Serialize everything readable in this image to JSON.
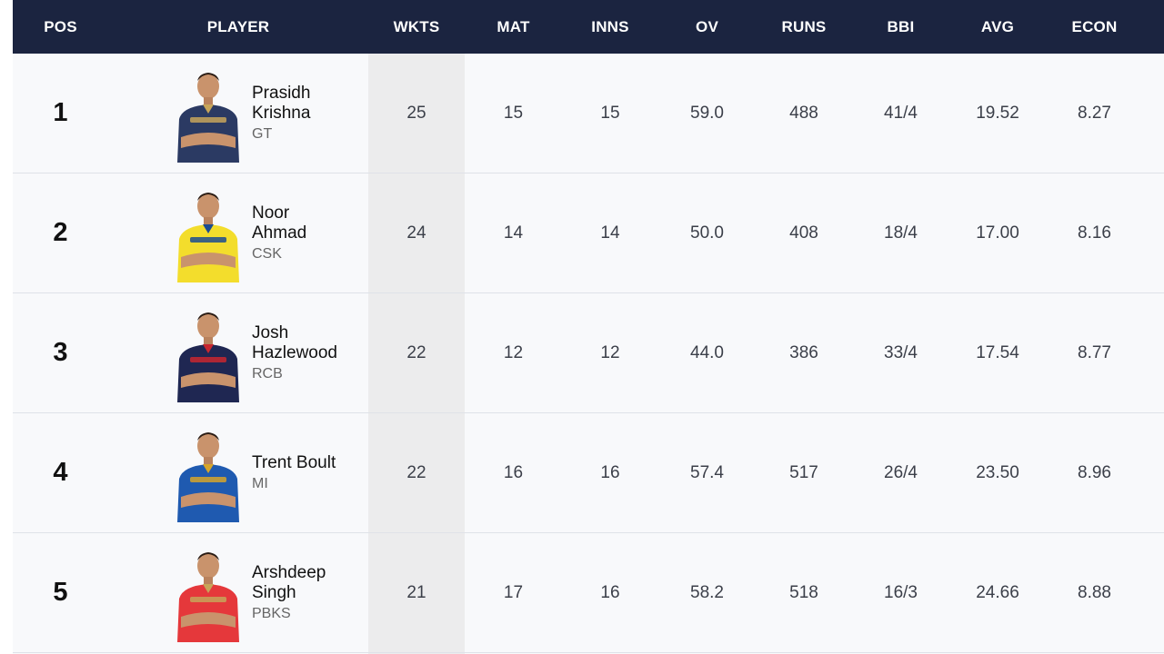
{
  "header": {
    "pos": "POS",
    "player": "PLAYER",
    "wkts": "WKTS",
    "mat": "MAT",
    "inns": "INNS",
    "ov": "OV",
    "runs": "RUNS",
    "bbi": "BBI",
    "avg": "AVG",
    "econ": "ECON"
  },
  "rows": [
    {
      "pos": "1",
      "first": "Prasidh",
      "last": "Krishna",
      "team": "GT",
      "jersey": "#2b3a63",
      "trim": "#c7a55a",
      "wkts": "25",
      "mat": "15",
      "inns": "15",
      "ov": "59.0",
      "runs": "488",
      "bbi": "41/4",
      "avg": "19.52",
      "econ": "8.27"
    },
    {
      "pos": "2",
      "first": "Noor",
      "last": "Ahmad",
      "team": "CSK",
      "jersey": "#f3dd2c",
      "trim": "#1b4c91",
      "wkts": "24",
      "mat": "14",
      "inns": "14",
      "ov": "50.0",
      "runs": "408",
      "bbi": "18/4",
      "avg": "17.00",
      "econ": "8.16"
    },
    {
      "pos": "3",
      "first": "Josh",
      "last": "Hazlewood",
      "team": "RCB",
      "jersey": "#1f2752",
      "trim": "#c8272f",
      "wkts": "22",
      "mat": "12",
      "inns": "12",
      "ov": "44.0",
      "runs": "386",
      "bbi": "33/4",
      "avg": "17.54",
      "econ": "8.77"
    },
    {
      "pos": "4",
      "first": "Trent Boult",
      "last": "",
      "team": "MI",
      "jersey": "#1f5ab0",
      "trim": "#d6a52b",
      "wkts": "22",
      "mat": "16",
      "inns": "16",
      "ov": "57.4",
      "runs": "517",
      "bbi": "26/4",
      "avg": "23.50",
      "econ": "8.96"
    },
    {
      "pos": "5",
      "first": "Arshdeep",
      "last": "Singh",
      "team": "PBKS",
      "jersey": "#e5383b",
      "trim": "#c7a55a",
      "wkts": "21",
      "mat": "17",
      "inns": "16",
      "ov": "58.2",
      "runs": "518",
      "bbi": "16/3",
      "avg": "24.66",
      "econ": "8.88"
    }
  ]
}
